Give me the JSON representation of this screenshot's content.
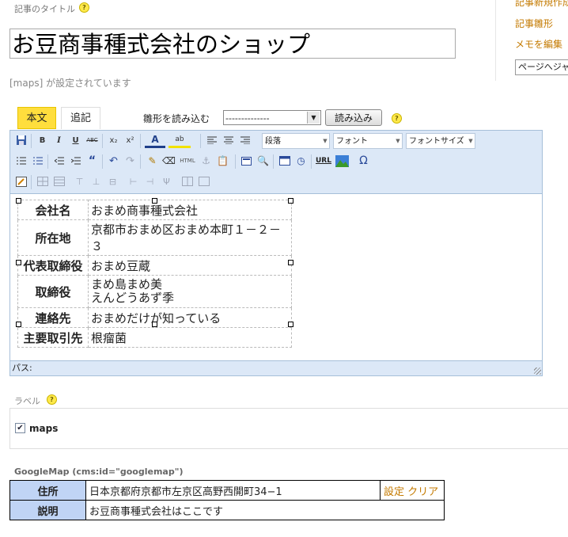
{
  "title_section": {
    "label": "記事のタイトル",
    "help": "?",
    "value": "お豆商事種式会社のショップ",
    "maps_note": "[maps] が設定されています"
  },
  "right_menu": {
    "links": [
      "記事新規作成",
      "記事雛形",
      "メモを編集"
    ],
    "page_jump": "ページへジャンプ"
  },
  "tabs": [
    {
      "label": "本文",
      "active": true
    },
    {
      "label": "追記",
      "active": false
    }
  ],
  "template": {
    "label": "雛形を読み込む",
    "select_value": "--------------",
    "load_button": "読み込み",
    "help": "?"
  },
  "toolbar": {
    "buttons_row1": [
      "save",
      "B",
      "I",
      "U",
      "ABC",
      "x₂",
      "x²",
      "A",
      "ab",
      "align-left",
      "align-center",
      "align-right"
    ],
    "format_select": "段落",
    "font_select": "フォント",
    "size_select": "フォントサイズ",
    "html_label": "HTML",
    "url_label": "URL",
    "omega_label": "Ω",
    "quote_label": "“"
  },
  "company_table": {
    "rows": [
      {
        "label": "会社名",
        "value": "おまめ商事種式会社"
      },
      {
        "label": "所在地",
        "value": "京都市おまめ区おまめ本町１－２－３"
      },
      {
        "label": "代表取締役",
        "value": "おまめ豆蔵"
      },
      {
        "label": "取締役",
        "value_line1": "まめ島まめ美",
        "value_line2": "えんどうあず季"
      },
      {
        "label": "連絡先",
        "value": "おまめだけが知っている"
      },
      {
        "label": "主要取引先",
        "value": "根瘤菌"
      }
    ]
  },
  "path_bar": {
    "label": "パス:"
  },
  "label_section": {
    "title": "ラベル",
    "help": "?",
    "checkbox_label": "maps",
    "checked": true
  },
  "googlemap": {
    "title": "GoogleMap (cms:id=\"googlemap\")",
    "address_label": "住所",
    "address_value": "日本京都府京都市左京区高野西開町34−1",
    "settings_link": "設定",
    "clear_link": "クリア",
    "desc_label": "説明",
    "desc_value": "お豆商事種式会社はここです"
  },
  "colors": {
    "tab_active": "#ffde3d",
    "toolbar_bg": "#dce8f7",
    "map_header": "#c0d4f5",
    "link": "#c47a00"
  }
}
